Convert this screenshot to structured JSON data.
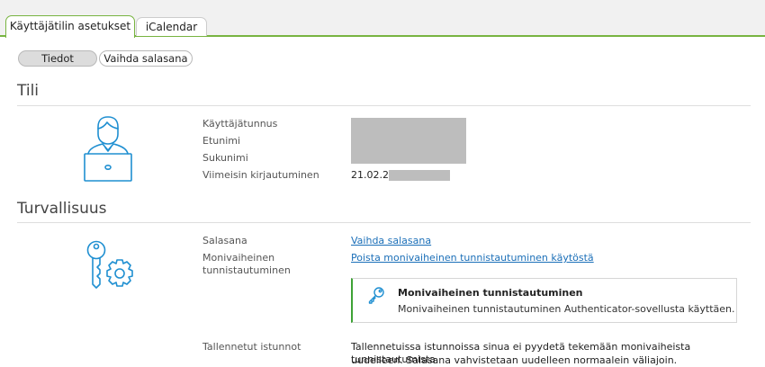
{
  "tabs": [
    {
      "label": "Käyttäjätilin asetukset",
      "active": true
    },
    {
      "label": "iCalendar",
      "active": false
    }
  ],
  "subnav": {
    "tiedot": "Tiedot",
    "vaihda_salasana": "Vaihda salasana"
  },
  "tili": {
    "title": "Tili",
    "fields": [
      {
        "label": "Käyttäjätunnus",
        "value": ""
      },
      {
        "label": "Etunimi",
        "value": ""
      },
      {
        "label": "Sukunimi",
        "value": ""
      },
      {
        "label": "Viimeisin kirjautuminen",
        "value": "21.02.20"
      }
    ]
  },
  "turvallisuus": {
    "title": "Turvallisuus",
    "salasana_label": "Salasana",
    "salasana_link": "Vaihda salasana",
    "mfa_label": "Monivaiheinen tunnistautuminen",
    "mfa_link": "Poista monivaiheinen tunnistautuminen käytöstä",
    "info_title": "Monivaiheinen tunnistautuminen",
    "info_text": "Monivaiheinen tunnistautuminen Authenticator-sovellusta käyttäen.",
    "sessions_label": "Tallennetut istunnot",
    "sessions_text_1": "Tallennetuissa istunnoissa sinua ei pyydetä tekemään monivaiheista tunnistautumista",
    "sessions_text_2": "uudelleen. Salasana vahvistetaan uudelleen normaalein väliajoin."
  },
  "colors": {
    "accent": "#78b441",
    "link": "#1b6fb8",
    "icon": "#1f8fd1",
    "info_border": "#3ea236"
  },
  "icons": [
    "user-laptop-icon",
    "keys-settings-icon",
    "key-icon"
  ]
}
